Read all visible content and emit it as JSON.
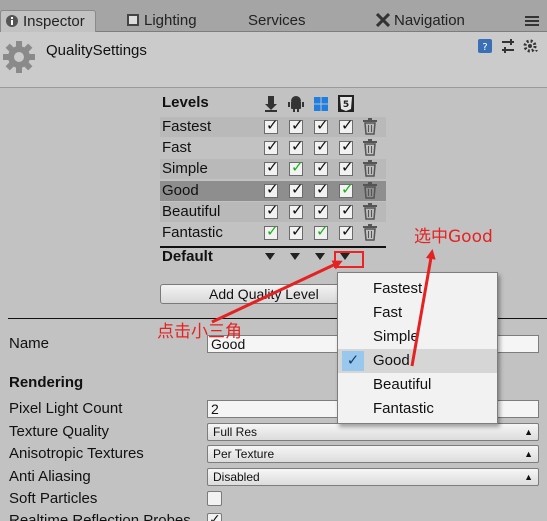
{
  "tabs": [
    {
      "label": "Inspector",
      "icon": "info-icon",
      "active": true
    },
    {
      "label": "Lighting",
      "icon": "lighting-icon"
    },
    {
      "label": "Services",
      "icon": ""
    },
    {
      "label": "Navigation",
      "icon": "navigation-icon"
    }
  ],
  "header": {
    "title": "QualitySettings"
  },
  "levels": {
    "label": "Levels",
    "platforms": [
      "standalone-icon",
      "android-icon",
      "windows-store-icon",
      "webgl-html5-icon"
    ],
    "rows": [
      {
        "name": "Fastest",
        "checks": [
          "on",
          "on",
          "on",
          "on"
        ]
      },
      {
        "name": "Fast",
        "checks": [
          "on",
          "on",
          "on",
          "on"
        ]
      },
      {
        "name": "Simple",
        "checks": [
          "on",
          "default",
          "on",
          "on"
        ]
      },
      {
        "name": "Good",
        "checks": [
          "on",
          "on",
          "on",
          "default"
        ],
        "selected": true
      },
      {
        "name": "Beautiful",
        "checks": [
          "on",
          "on",
          "on",
          "on"
        ]
      },
      {
        "name": "Fantastic",
        "checks": [
          "default",
          "on",
          "default",
          "on"
        ]
      }
    ],
    "default_label": "Default",
    "add_button": "Add Quality Level"
  },
  "dropdown": {
    "items": [
      "Fastest",
      "Fast",
      "Simple",
      "Good",
      "Beautiful",
      "Fantastic"
    ],
    "selected": "Good"
  },
  "annotations": {
    "click_triangle": "点击小三角",
    "select_good": "选中Good"
  },
  "properties": {
    "name_label": "Name",
    "name_value": "Good",
    "rendering_heading": "Rendering",
    "pixel_light_count_label": "Pixel Light Count",
    "pixel_light_count_value": "2",
    "texture_quality_label": "Texture Quality",
    "texture_quality_value": "Full Res",
    "anisotropic_label": "Anisotropic Textures",
    "anisotropic_value": "Per Texture",
    "anti_aliasing_label": "Anti Aliasing",
    "anti_aliasing_value": "Disabled",
    "soft_particles_label": "Soft Particles",
    "soft_particles_checked": false,
    "realtime_reflection_label": "Realtime Reflection Probes",
    "realtime_reflection_checked": true
  },
  "colors": {
    "check_green": "#19b219",
    "annotation_red": "#e52222",
    "selection_blue": "#99c8ef"
  }
}
